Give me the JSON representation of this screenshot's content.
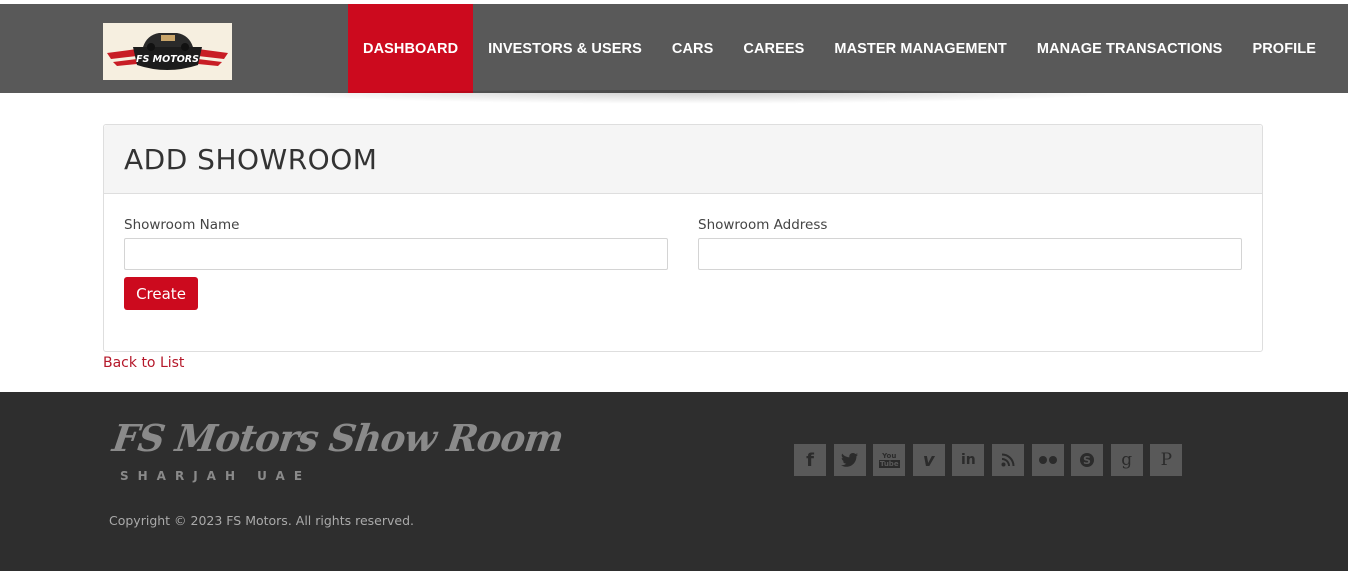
{
  "header": {
    "logo_text": "FS MOTORS",
    "nav": [
      {
        "label": "DASHBOARD",
        "active": true
      },
      {
        "label": "INVESTORS & USERS",
        "active": false
      },
      {
        "label": "CARS",
        "active": false
      },
      {
        "label": "CAREES",
        "active": false
      },
      {
        "label": "MASTER MANAGEMENT",
        "active": false
      },
      {
        "label": "MANAGE TRANSACTIONS",
        "active": false
      },
      {
        "label": "PROFILE",
        "active": false
      }
    ]
  },
  "form": {
    "title": "ADD SHOWROOM",
    "name_label": "Showroom Name",
    "name_value": "",
    "address_label": "Showroom Address",
    "address_value": "",
    "submit_label": "Create"
  },
  "back_link": "Back to List",
  "footer": {
    "brand": "FS Motors Show Room",
    "location": "SHARJAH UAE",
    "copyright": "Copyright © 2023 FS Motors. All rights reserved.",
    "social": [
      {
        "icon": "facebook-icon",
        "glyph": "f"
      },
      {
        "icon": "twitter-icon",
        "glyph": "🐦"
      },
      {
        "icon": "youtube-icon",
        "glyph": "You Tube"
      },
      {
        "icon": "vimeo-icon",
        "glyph": "v"
      },
      {
        "icon": "linkedin-icon",
        "glyph": "in"
      },
      {
        "icon": "rss-icon",
        "glyph": "rss"
      },
      {
        "icon": "flickr-icon",
        "glyph": "●●"
      },
      {
        "icon": "skype-icon",
        "glyph": "S"
      },
      {
        "icon": "google-plus-icon",
        "glyph": "g"
      },
      {
        "icon": "pinterest-icon",
        "glyph": "P"
      }
    ]
  },
  "colors": {
    "accent": "#cc0a1e",
    "header_bg": "#595959",
    "footer_bg": "#2e2e2e"
  }
}
